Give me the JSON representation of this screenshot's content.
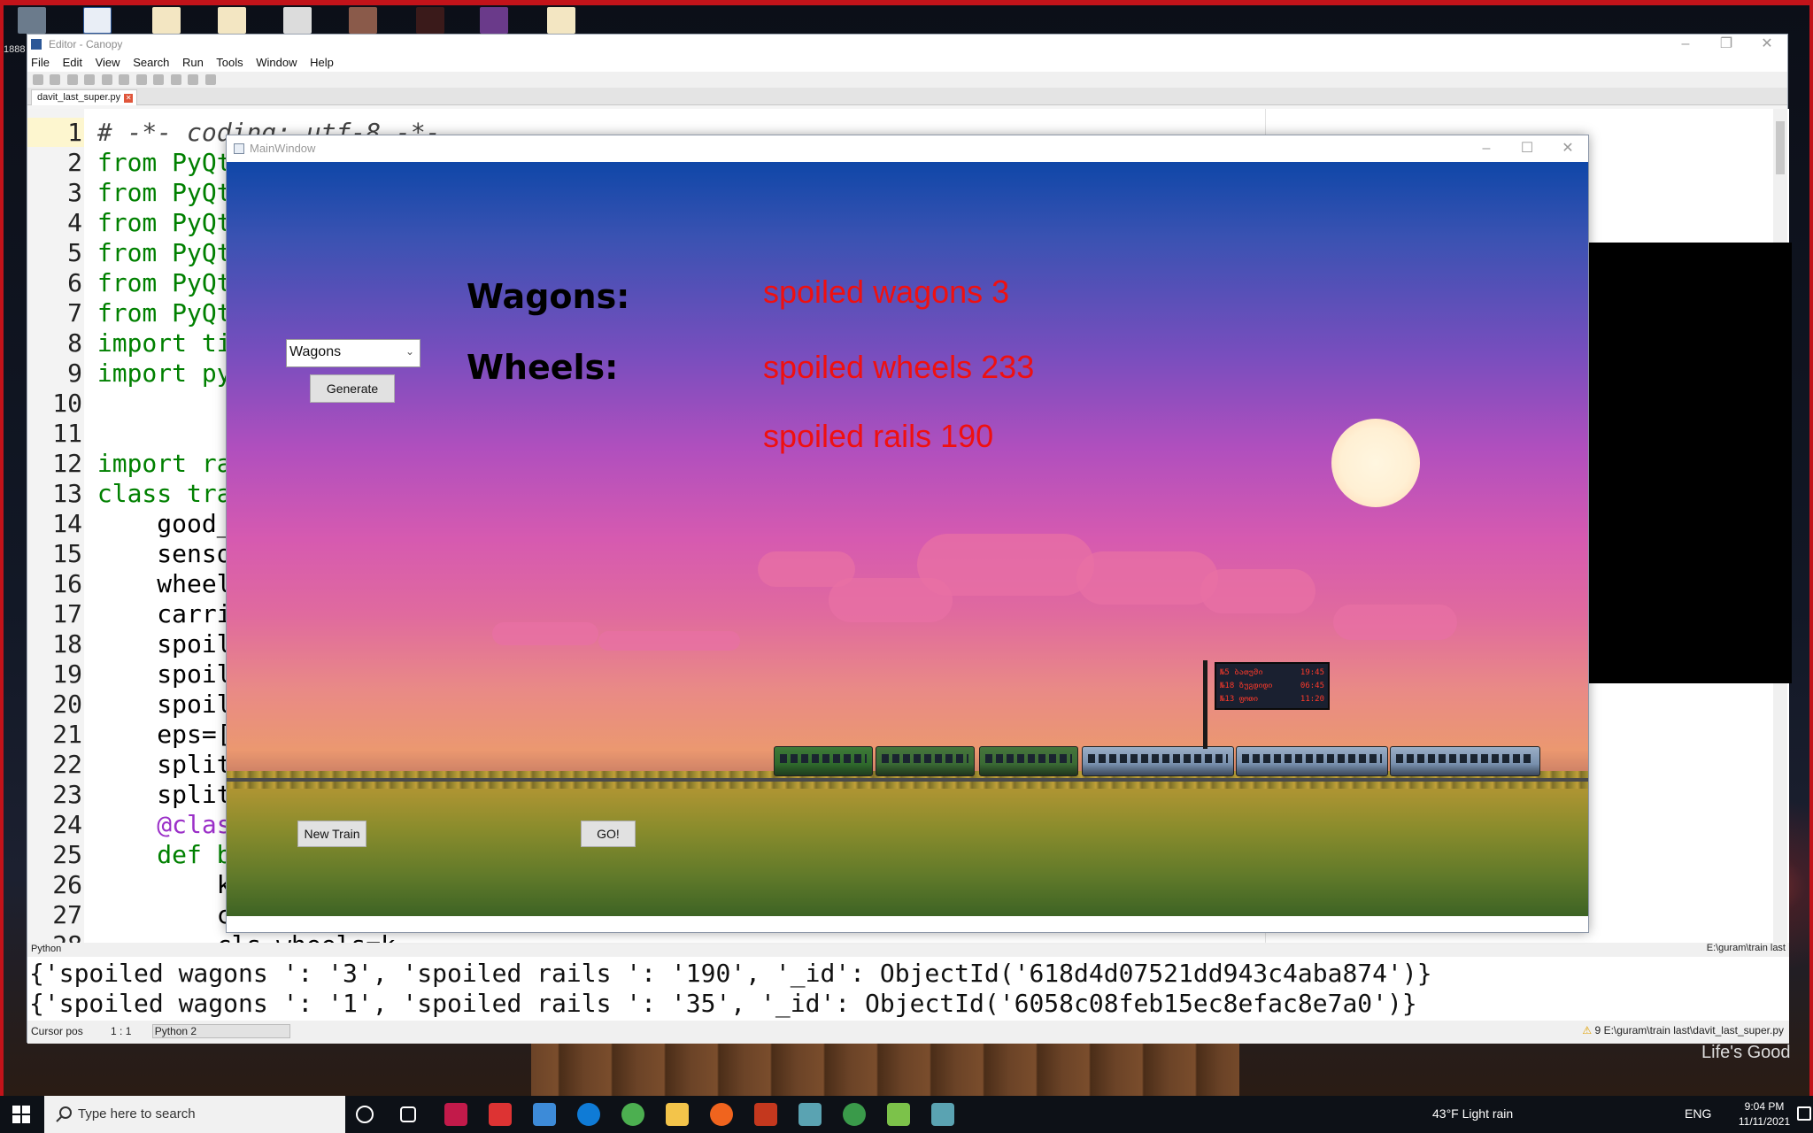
{
  "desktop": {
    "side_label": "1888",
    "footer_brand": "Life's Good"
  },
  "canopy": {
    "title": "Editor - Canopy",
    "menu": [
      "File",
      "Edit",
      "View",
      "Search",
      "Run",
      "Tools",
      "Window",
      "Help"
    ],
    "tab_label": "davit_last_super.py",
    "code_lines": [
      {
        "n": "1",
        "text": "# -*- coding: utf-8 -*-"
      },
      {
        "n": "2",
        "text": "from PyQt"
      },
      {
        "n": "3",
        "text": "from PyQt"
      },
      {
        "n": "4",
        "text": "from PyQt"
      },
      {
        "n": "5",
        "text": "from PyQt"
      },
      {
        "n": "6",
        "text": "from PyQt"
      },
      {
        "n": "7",
        "text": "from PyQt"
      },
      {
        "n": "8",
        "text": "import ti"
      },
      {
        "n": "9",
        "text": "import py"
      },
      {
        "n": "10",
        "text": ""
      },
      {
        "n": "11",
        "text": ""
      },
      {
        "n": "12",
        "text": "import ra"
      },
      {
        "n": "13",
        "text": "class tra"
      },
      {
        "n": "14",
        "text": "    good_w"
      },
      {
        "n": "15",
        "text": "    sensor"
      },
      {
        "n": "16",
        "text": "    wheels"
      },
      {
        "n": "17",
        "text": "    carria"
      },
      {
        "n": "18",
        "text": "    spoile"
      },
      {
        "n": "19",
        "text": "    spoile"
      },
      {
        "n": "20",
        "text": "    spoile"
      },
      {
        "n": "21",
        "text": "    eps=[@"
      },
      {
        "n": "22",
        "text": "    splite"
      },
      {
        "n": "23",
        "text": "    splite"
      },
      {
        "n": "24",
        "text": "    @class"
      },
      {
        "n": "25",
        "text": "    def bo"
      },
      {
        "n": "26",
        "text": "        k="
      },
      {
        "n": "27",
        "text": "        c="
      },
      {
        "n": "28",
        "text": "        cls.wheels=k"
      }
    ],
    "status_language": "Python",
    "status_path": "E:\\guram\\train last",
    "console_lines": [
      "{'spoiled wagons ': '3', 'spoiled rails ': '190', '_id': ObjectId('618d4d07521dd943c4aba874')}",
      "{'spoiled wagons ': '1', 'spoiled rails ': '35', '_id': ObjectId('6058c08feb15ec8efac8e7a0')}"
    ],
    "cursor_pos_label": "Cursor pos",
    "cursor_pos_value": "1 : 1",
    "interpreter": "Python 2",
    "file_path": "E:\\guram\\train last\\davit_last_super.py",
    "warning_count": "9"
  },
  "mainwindow": {
    "title": "MainWindow",
    "combo_value": "Wagons",
    "generate_label": "Generate",
    "wagons_label": "Wagons:",
    "wheels_label": "Wheels:",
    "spoiled_wagons": "spoiled wagons 3",
    "spoiled_wheels": "spoiled wheels 233",
    "spoiled_rails": "spoiled rails 190",
    "new_train_label": "New Train",
    "go_label": "GO!",
    "board_rows": [
      {
        "train": "№5 ბათუმი",
        "time": "19:45"
      },
      {
        "train": "№18 ზუგდიდი",
        "time": "06:45"
      },
      {
        "train": "№13 ფოთი",
        "time": "11:20"
      }
    ]
  },
  "taskbar": {
    "search_placeholder": "Type here to search",
    "weather": "43°F  Light rain",
    "language": "ENG",
    "time": "9:04 PM",
    "date": "11/11/2021"
  },
  "colors": {
    "accent_red": "#ef1010",
    "keyword_green": "#008000"
  }
}
